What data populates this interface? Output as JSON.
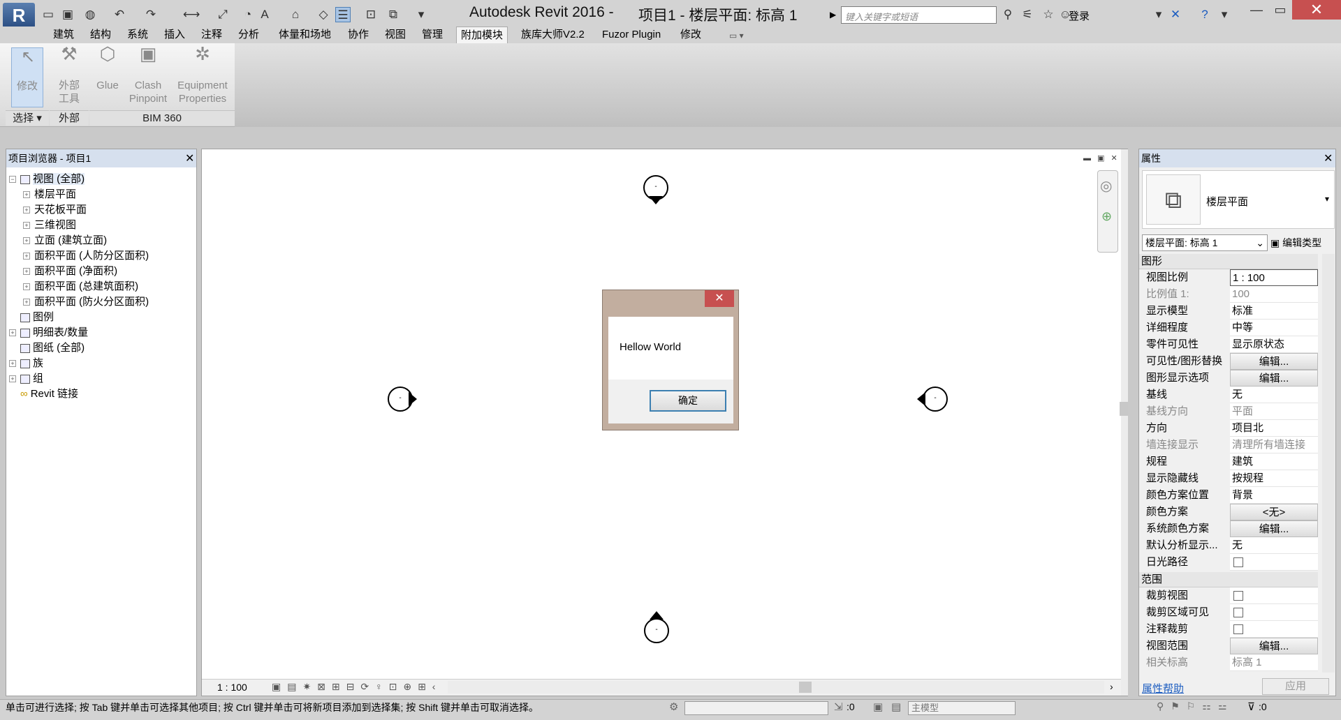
{
  "title_bar": {
    "app_title": "Autodesk Revit 2016 -",
    "view_title": "项目1 - 楼层平面: 标高 1",
    "search_placeholder": "键入关键字或短语",
    "login": "登录"
  },
  "tabs": [
    {
      "label": "建筑"
    },
    {
      "label": "结构"
    },
    {
      "label": "系统"
    },
    {
      "label": "插入"
    },
    {
      "label": "注释"
    },
    {
      "label": "分析"
    },
    {
      "label": "体量和场地"
    },
    {
      "label": "协作"
    },
    {
      "label": "视图"
    },
    {
      "label": "管理"
    },
    {
      "label": "附加模块",
      "active": true
    },
    {
      "label": "族库大师V2.2"
    },
    {
      "label": "Fuzor Plugin"
    },
    {
      "label": "修改"
    }
  ],
  "ribbon": {
    "modify": "修改",
    "external_tools_1": "外部",
    "external_tools_2": "工具",
    "glue": "Glue",
    "clash_1": "Clash",
    "clash_2": "Pinpoint",
    "equip_1": "Equipment",
    "equip_2": "Properties",
    "panel_select": "选择",
    "panel_external": "外部",
    "panel_bim360": "BIM 360"
  },
  "project_browser": {
    "title": "项目浏览器 - 项目1",
    "items": [
      {
        "label": "视图 (全部)",
        "level": 0,
        "icon": "views-icon"
      },
      {
        "label": "楼层平面",
        "level": 1
      },
      {
        "label": "天花板平面",
        "level": 1
      },
      {
        "label": "三维视图",
        "level": 1
      },
      {
        "label": "立面 (建筑立面)",
        "level": 1
      },
      {
        "label": "面积平面 (人防分区面积)",
        "level": 1
      },
      {
        "label": "面积平面 (净面积)",
        "level": 1
      },
      {
        "label": "面积平面 (总建筑面积)",
        "level": 1
      },
      {
        "label": "面积平面 (防火分区面积)",
        "level": 1
      },
      {
        "label": "图例",
        "level": 0,
        "icon": "legend-icon"
      },
      {
        "label": "明细表/数量",
        "level": 0,
        "icon": "schedule-icon"
      },
      {
        "label": "图纸 (全部)",
        "level": 0,
        "icon": "sheet-icon"
      },
      {
        "label": "族",
        "level": 0,
        "icon": "family-icon"
      },
      {
        "label": "组",
        "level": 0,
        "icon": "group-icon"
      },
      {
        "label": "Revit 链接",
        "level": 0,
        "icon": "link-icon"
      }
    ]
  },
  "canvas": {
    "scale": "1 : 100",
    "marker_label": "-"
  },
  "dialog": {
    "message": "Hellow World",
    "ok": "确定"
  },
  "properties": {
    "title": "属性",
    "type_name": "楼层平面",
    "instance_selector": "楼层平面: 标高 1",
    "edit_type": "编辑类型",
    "group_graphics": "图形",
    "group_extents": "范围",
    "rows_graphics": [
      {
        "key": "视图比例",
        "value": "1 : 100"
      },
      {
        "key": "比例值 1:",
        "value": "100",
        "readonly": true
      },
      {
        "key": "显示模型",
        "value": "标准"
      },
      {
        "key": "详细程度",
        "value": "中等"
      },
      {
        "key": "零件可见性",
        "value": "显示原状态"
      },
      {
        "key": "可见性/图形替换",
        "value": "编辑...",
        "button": true
      },
      {
        "key": "图形显示选项",
        "value": "编辑...",
        "button": true
      },
      {
        "key": "基线",
        "value": "无"
      },
      {
        "key": "基线方向",
        "value": "平面",
        "readonly": true
      },
      {
        "key": "方向",
        "value": "项目北"
      },
      {
        "key": "墙连接显示",
        "value": "清理所有墙连接",
        "readonly": true
      },
      {
        "key": "规程",
        "value": "建筑"
      },
      {
        "key": "显示隐藏线",
        "value": "按规程"
      },
      {
        "key": "颜色方案位置",
        "value": "背景"
      },
      {
        "key": "颜色方案",
        "value": "<无>",
        "button": true
      },
      {
        "key": "系统颜色方案",
        "value": "编辑...",
        "button": true
      },
      {
        "key": "默认分析显示...",
        "value": "无"
      },
      {
        "key": "日光路径",
        "value": "",
        "checkbox": true
      }
    ],
    "rows_extents": [
      {
        "key": "裁剪视图",
        "value": "",
        "checkbox": true
      },
      {
        "key": "裁剪区域可见",
        "value": "",
        "checkbox": true
      },
      {
        "key": "注释裁剪",
        "value": "",
        "checkbox": true
      },
      {
        "key": "视图范围",
        "value": "编辑...",
        "button": true
      },
      {
        "key": "相关标高",
        "value": "标高 1",
        "readonly": true
      }
    ],
    "help": "属性帮助",
    "apply": "应用"
  },
  "status_bar": {
    "text": "单击可进行选择; 按 Tab 键并单击可选择其他项目; 按 Ctrl 键并单击可将新项目添加到选择集; 按 Shift 键并单击可取消选择。",
    "worksets_count": ":0",
    "model": "主模型",
    "filter_count": ":0"
  }
}
